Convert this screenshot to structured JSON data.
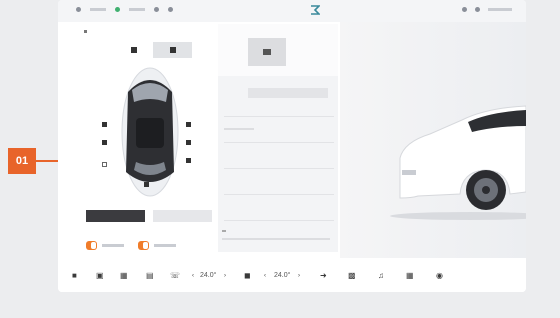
{
  "annotation": {
    "label": "01"
  },
  "dock": {
    "temp_left": "24.0°",
    "temp_right": "24.0°"
  },
  "colors": {
    "accent": "#e8642a",
    "switch_on": "#f07c2a"
  }
}
